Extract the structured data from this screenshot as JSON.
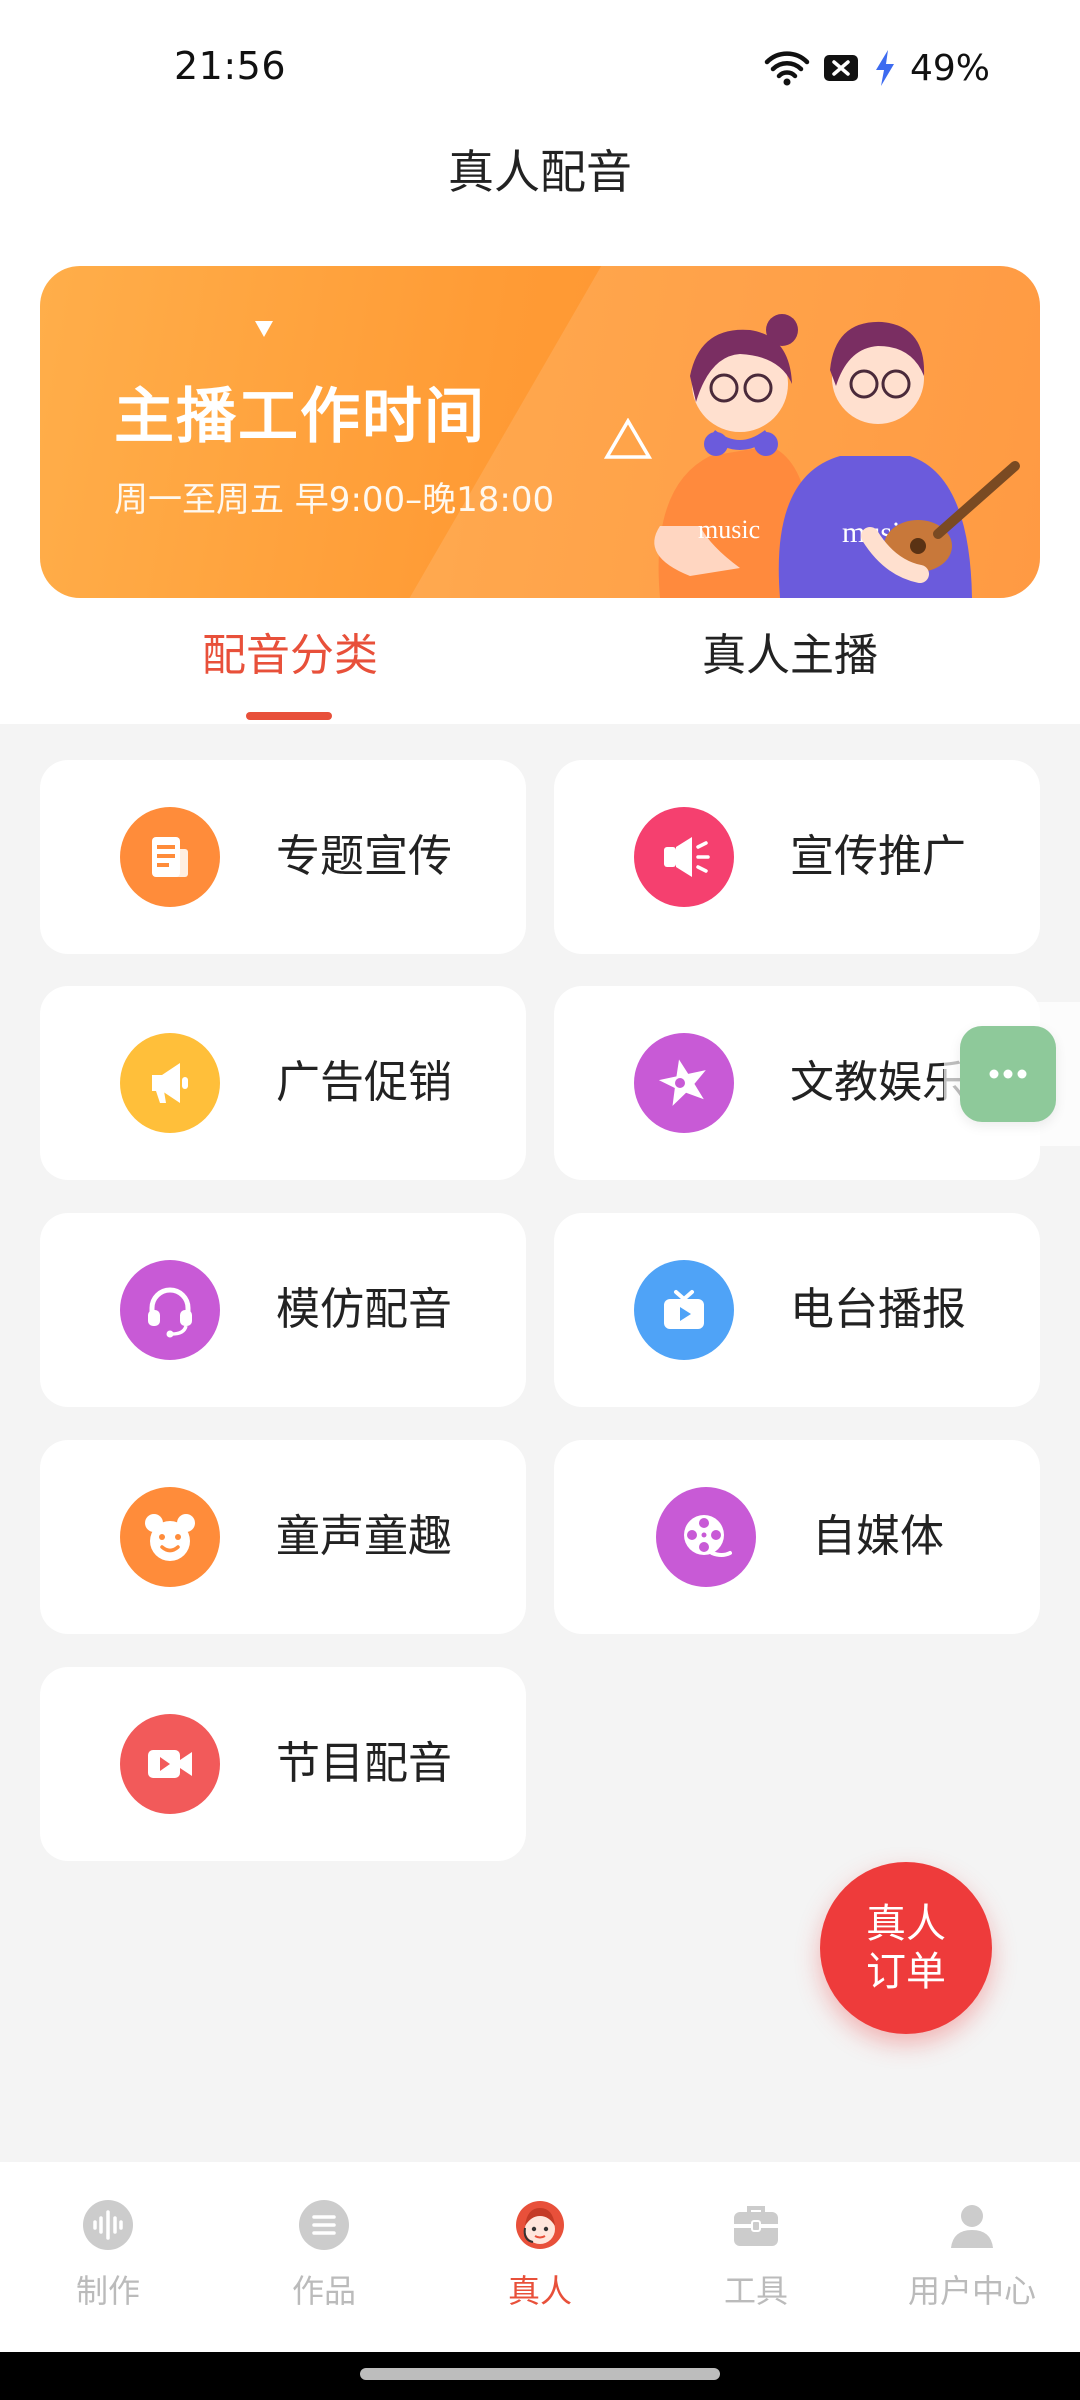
{
  "status_bar": {
    "time": "21:56",
    "battery": "49%"
  },
  "header": {
    "title": "真人配音"
  },
  "banner": {
    "heading": "主播工作时间",
    "subtitle": "周一至周五 早9:00–晚18:00",
    "shirt_text": "music"
  },
  "tabs": [
    {
      "label": "配音分类",
      "active": true
    },
    {
      "label": "真人主播",
      "active": false
    }
  ],
  "categories": [
    {
      "label": "专题宣传",
      "icon": "document-icon",
      "color": "#ff8c3a"
    },
    {
      "label": "宣传推广",
      "icon": "megaphone-icon",
      "color": "#f5406f"
    },
    {
      "label": "广告促销",
      "icon": "speaker-icon",
      "color": "#ffbf3a"
    },
    {
      "label": "文教娱乐",
      "icon": "star-icon",
      "color": "#c85ad6"
    },
    {
      "label": "模仿配音",
      "icon": "headset-icon",
      "color": "#c85ad6"
    },
    {
      "label": "电台播报",
      "icon": "tv-icon",
      "color": "#4fa3f7"
    },
    {
      "label": "童声童趣",
      "icon": "bear-icon",
      "color": "#ff8c3a"
    },
    {
      "label": "自媒体",
      "icon": "film-reel-icon",
      "color": "#c85ad6"
    },
    {
      "label": "节目配音",
      "icon": "video-camera-icon",
      "color": "#f25a5a"
    }
  ],
  "order_button": {
    "line1": "真人",
    "line2": "订单"
  },
  "bottom_nav": [
    {
      "label": "制作",
      "icon": "waveform-icon",
      "active": false
    },
    {
      "label": "作品",
      "icon": "list-icon",
      "active": false
    },
    {
      "label": "真人",
      "icon": "host-avatar-icon",
      "active": true
    },
    {
      "label": "工具",
      "icon": "toolbox-icon",
      "active": false
    },
    {
      "label": "用户中心",
      "icon": "user-icon",
      "active": false
    }
  ],
  "colors": {
    "accent": "#e8503a",
    "order": "#ee3b3b",
    "chat_bubble": "#8ec99a"
  }
}
